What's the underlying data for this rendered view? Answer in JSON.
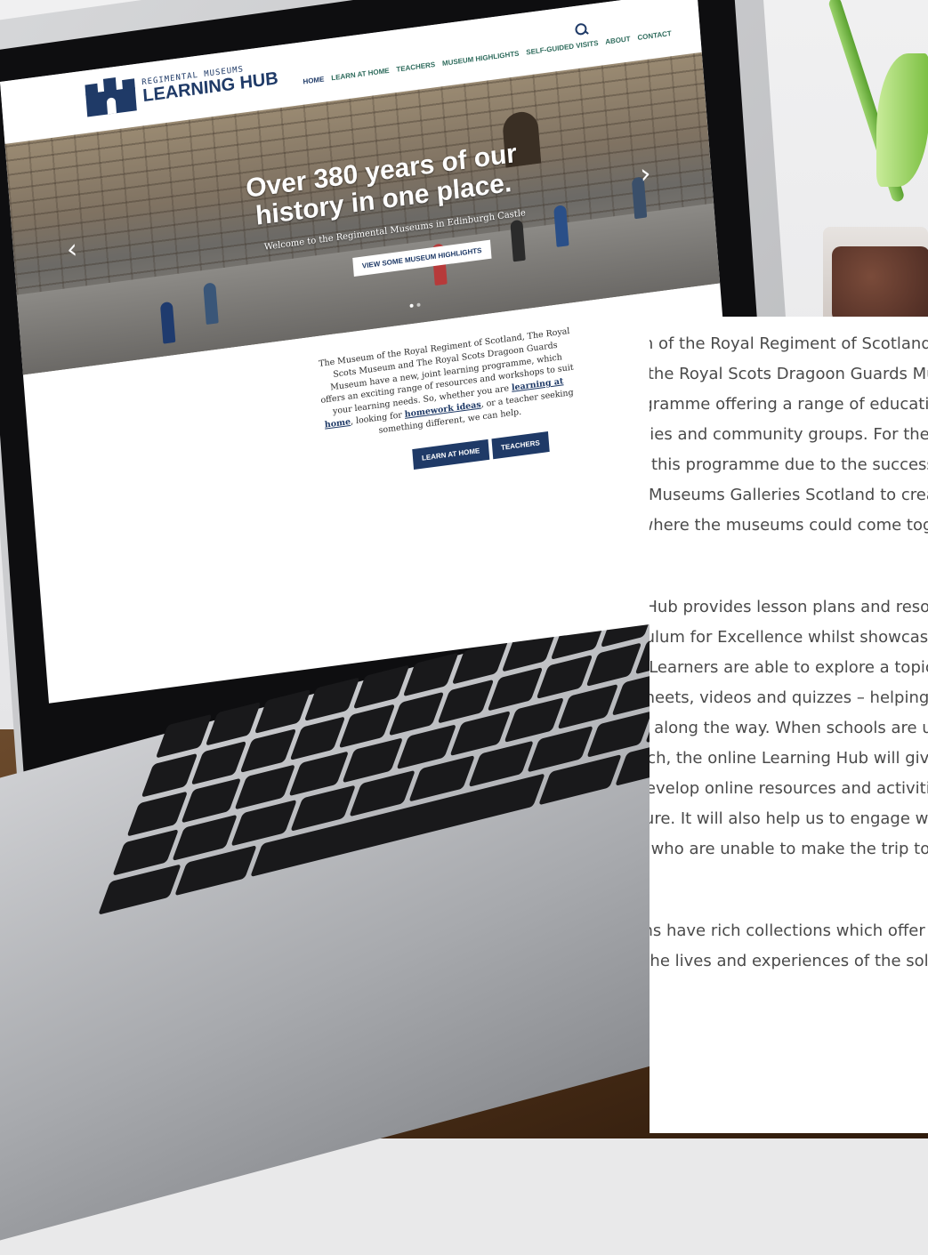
{
  "site": {
    "logo_small": "REGIMENTAL MUSEUMS",
    "logo_big": "LEARNING HUB",
    "nav": [
      "HOME",
      "LEARN AT HOME",
      "TEACHERS",
      "MUSEUM HIGHLIGHTS",
      "SELF-GUIDED VISITS",
      "ABOUT",
      "CONTACT"
    ],
    "nav_active": "HOME"
  },
  "hero": {
    "title": "Over 380 years of our history in one place.",
    "subtitle": "Welcome to the Regimental Museums in Edinburgh Castle",
    "button": "VIEW SOME MUSEUM HIGHLIGHTS",
    "prev_glyph": "‹",
    "next_glyph": "›"
  },
  "intro": {
    "text_1": "The Museum of the Royal Regiment of Scotland, The Royal Scots Museum and The Royal Scots Dragoon Guards Museum have a new, joint learning programme, which offers an exciting range of resources and workshops to suit your learning needs. So, whether you are ",
    "link_1": "learning at home",
    "text_2": ", looking for ",
    "link_2": "homework ideas",
    "text_3": ", or a teacher seeking something different, we can help.",
    "button_1": "LEARN AT HOME",
    "button_2": "TEACHERS"
  },
  "panel": {
    "para_1": "The Museum of the Royal Regiment of Scotland, The Royal Scots Museum and the Royal Scots Dragoon Guards Museum have a joint learning programme offering a range of educational resources for schools, families and community groups. For the first time we were able to create this programme due to the successful receipt of grant funding from Museums Galleries Scotland to create a Learning Hub where the museums could come together.",
    "para_2": "The Learning Hub provides lesson plans and resources that link with the Curriculum for Excellence whilst showcasing some of the collections. Learners are able to explore a topic through stories, objects, worksheets, videos and quizzes – helping them to learn more than expected along the way. When schools are unable to make face visits or outreach, the online Learning Hub will give us the opportunity to share and develop online resources and activities with the learners of the future. It will also help us to engage with schools and communities who are unable to make the trip to Edinburgh Castle.",
    "para_3": "Our museums have rich collections which offer learners a unique insight into the lives and experiences of the soldiers who served."
  }
}
